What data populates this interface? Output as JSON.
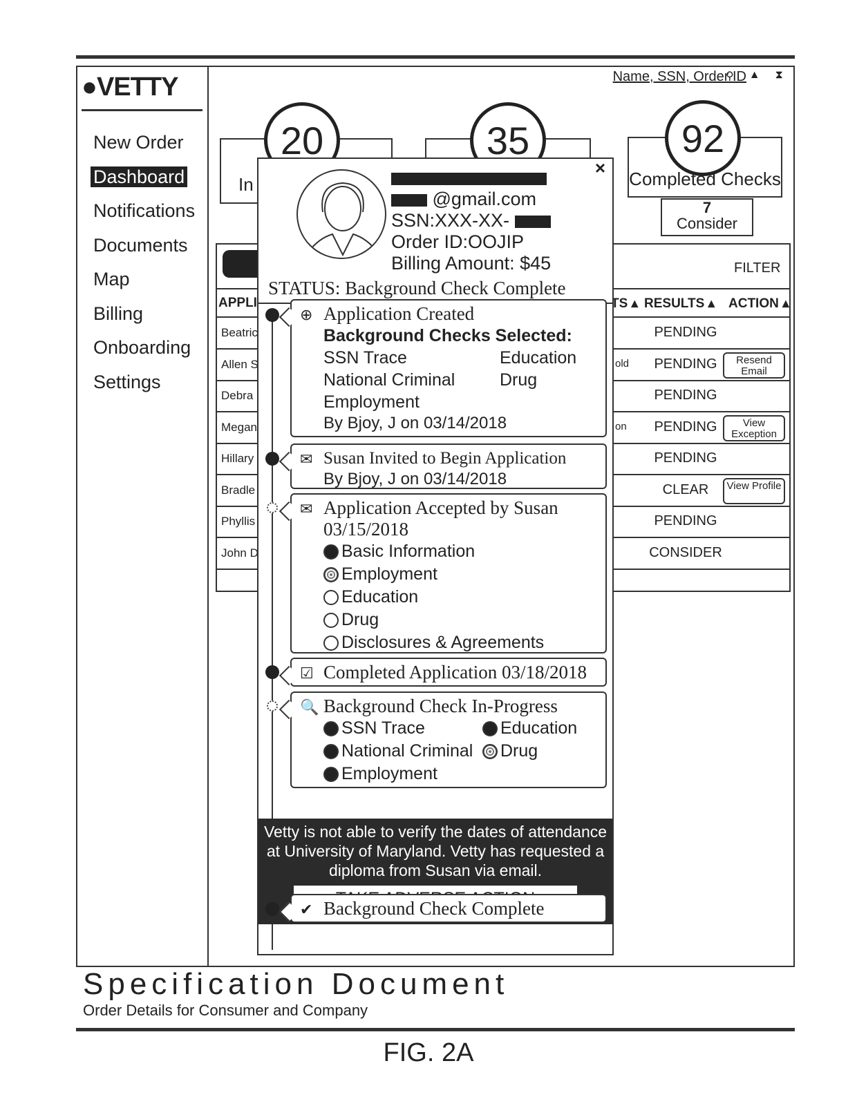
{
  "app": {
    "logo": "●VETTY",
    "search_placeholder": "Name, SSN, Order ID",
    "icons": {
      "search": "⚲",
      "notifications": "▲",
      "user": "⧗"
    }
  },
  "sidebar": {
    "items": [
      {
        "label": "New Order",
        "active": false
      },
      {
        "label": "Dashboard",
        "active": true
      },
      {
        "label": "Notifications",
        "active": false
      },
      {
        "label": "Documents",
        "active": false
      },
      {
        "label": "Map",
        "active": false
      },
      {
        "label": "Billing",
        "active": false
      },
      {
        "label": "Onboarding",
        "active": false
      },
      {
        "label": "Settings",
        "active": false
      }
    ]
  },
  "stats": [
    {
      "value": "20",
      "label": "In"
    },
    {
      "value": "35",
      "label": ""
    },
    {
      "value": "92",
      "label": "Completed Checks",
      "sub_value": "7",
      "sub_label": "Consider"
    }
  ],
  "table": {
    "filter_label": "FILTER",
    "headers": {
      "applicant": "APPLIC",
      "status": "TS ▴",
      "results": "RESULTS ▴",
      "action": "ACTION ▴"
    },
    "rows": [
      {
        "name": "Beatric",
        "status": "",
        "result": "PENDING",
        "action": ""
      },
      {
        "name": "Allen S",
        "status": "old",
        "result": "PENDING",
        "action": "Resend Email"
      },
      {
        "name": "Debra",
        "status": "",
        "result": "PENDING",
        "action": ""
      },
      {
        "name": "Megan",
        "status": "on",
        "result": "PENDING",
        "action": "View Exception"
      },
      {
        "name": "Hillary",
        "status": "",
        "result": "PENDING",
        "action": ""
      },
      {
        "name": "Bradle",
        "status": "",
        "result": "CLEAR",
        "action": "View Profile"
      },
      {
        "name": "Phyllis",
        "status": "",
        "result": "PENDING",
        "action": ""
      },
      {
        "name": "John D",
        "status": "",
        "result": "CONSIDER",
        "action": ""
      }
    ]
  },
  "modal": {
    "close": "×",
    "email_suffix": "@gmail.com",
    "ssn": "SSN:XXX-XX-",
    "order_id": "Order ID:OOJIP",
    "billing": "Billing Amount: $45",
    "status": "STATUS: Background Check Complete",
    "timeline": {
      "created": {
        "title": "Application Created",
        "heading": "Background Checks Selected:",
        "checks": [
          "SSN Trace",
          "Education",
          "National Criminal",
          "Drug",
          "Employment"
        ],
        "by": "By Bjoy, J on 03/14/2018"
      },
      "invited": {
        "title": "Susan Invited to Begin Application",
        "by": "By Bjoy, J on 03/14/2018"
      },
      "accepted": {
        "title": "Application Accepted by Susan",
        "date": "03/15/2018",
        "steps": [
          {
            "label": "Basic Information",
            "state": "complete"
          },
          {
            "label": "Employment",
            "state": "in-progress"
          },
          {
            "label": "Education",
            "state": "not-started"
          },
          {
            "label": "Drug",
            "state": "not-started"
          },
          {
            "label": "Disclosures & Agreements",
            "state": "not-started"
          }
        ]
      },
      "completed": {
        "title": "Completed Application 03/18/2018"
      },
      "in_progress": {
        "title": "Background Check In-Progress",
        "checks": [
          {
            "label": "SSN Trace",
            "state": "complete"
          },
          {
            "label": "Education",
            "state": "complete"
          },
          {
            "label": "National Criminal",
            "state": "complete"
          },
          {
            "label": "Drug",
            "state": "in-progress"
          },
          {
            "label": "Employment",
            "state": "complete"
          }
        ]
      },
      "alert": {
        "message": "Vetty is not able to verify the dates of attendance at University of Maryland. Vetty has requested a diploma from Susan via email.",
        "button": "TAKE ADVERSE ACTION"
      },
      "complete": {
        "title": "Background Check Complete"
      }
    }
  },
  "caption": {
    "title": "Specification Document",
    "subtitle": "Order Details for Consumer and Company",
    "figure": "FIG. 2A"
  }
}
